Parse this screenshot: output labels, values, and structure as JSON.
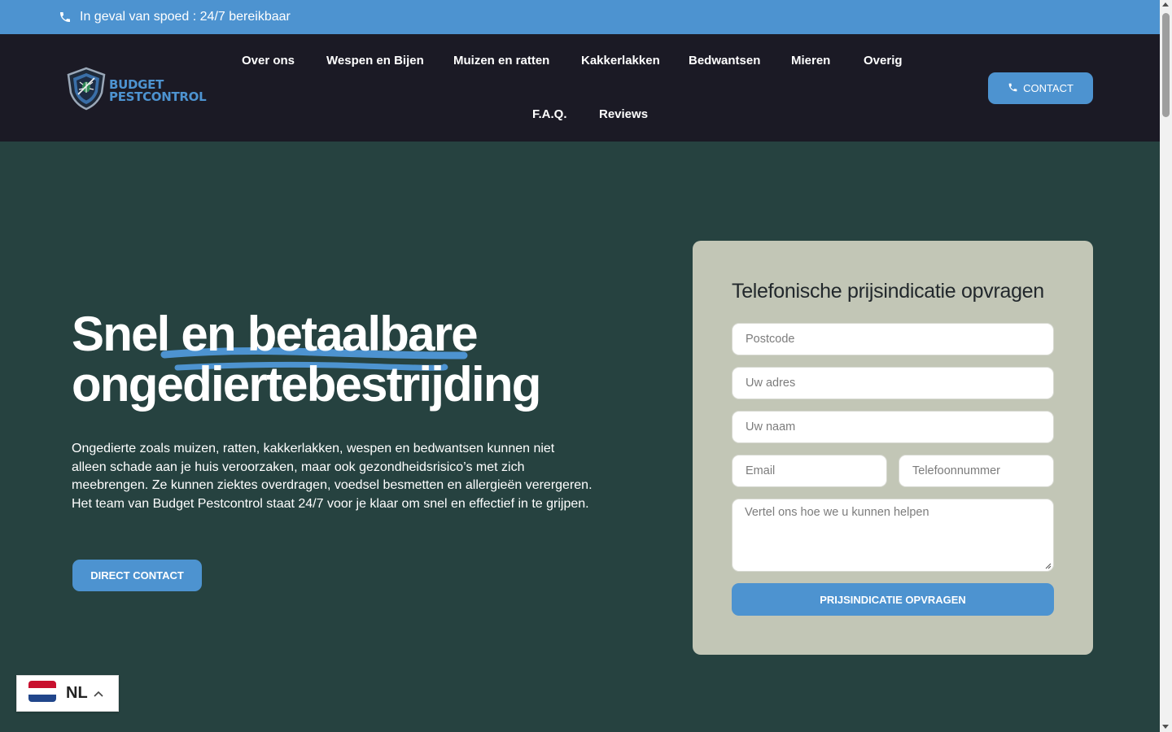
{
  "topbar": {
    "text": "In geval van spoed : 24/7 bereikbaar",
    "icon": "phone-icon"
  },
  "header": {
    "logo": {
      "line1": "BUDGET",
      "line2": "PESTCONTROL"
    },
    "nav": [
      {
        "label": "Over ons"
      },
      {
        "label": "Wespen en Bijen"
      },
      {
        "label": "Muizen en ratten"
      },
      {
        "label": "Kakkerlakken"
      },
      {
        "label": "Bedwantsen"
      },
      {
        "label": "Mieren"
      },
      {
        "label": "Overig"
      },
      {
        "label": "F.A.Q."
      },
      {
        "label": "Reviews"
      }
    ],
    "contact_label": "CONTACT"
  },
  "hero": {
    "title_line1": "Snel en betaalbare",
    "title_line2": "ongediertebestrijding",
    "paragraph": "Ongedierte zoals muizen, ratten, kakkerlakken, wespen en bedwantsen kunnen niet alleen schade aan je huis veroorzaken, maar ook gezondheidsrisico’s met zich meebrengen. Ze kunnen ziektes overdragen, voedsel besmetten en allergieën verergeren. Het team van Budget Pestcontrol staat 24/7 voor je klaar om snel en effectief in te grijpen.",
    "button_label": "DIRECT CONTACT"
  },
  "form": {
    "title": "Telefonische prijsindicatie opvragen",
    "postcode_placeholder": "Postcode",
    "address_placeholder": "Uw adres",
    "name_placeholder": "Uw naam",
    "email_placeholder": "Email",
    "phone_placeholder": "Telefoonnummer",
    "message_placeholder": "Vertel ons hoe we u kunnen helpen",
    "submit_label": "PRIJSINDICATIE OPVRAGEN"
  },
  "language": {
    "code": "NL"
  },
  "colors": {
    "accent": "#4d93d0",
    "header_bg": "#1b1a25",
    "hero_bg": "#264240",
    "card_bg": "#c2c6b6"
  }
}
